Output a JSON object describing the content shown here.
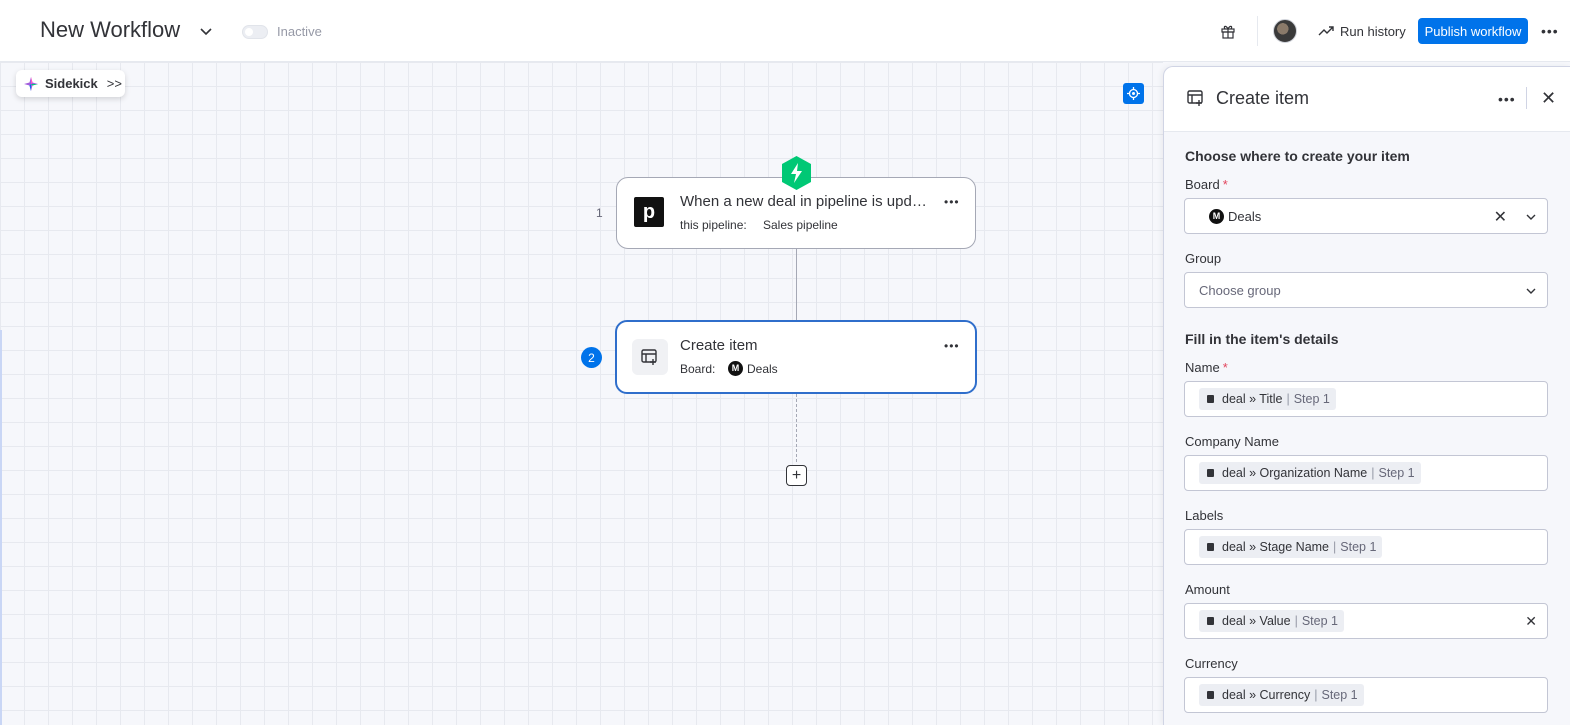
{
  "header": {
    "title": "New Workflow",
    "status": "Inactive",
    "run_history": "Run history",
    "publish": "Publish workflow"
  },
  "canvas": {
    "sidekick": "Sidekick",
    "nodes": [
      {
        "number": "1",
        "title": "When a new deal in pipeline is updated",
        "sub_label": "this pipeline:",
        "sub_value": "Sales pipeline",
        "logo_letter": "p"
      },
      {
        "number": "2",
        "title": "Create item",
        "sub_label": "Board:",
        "board_letter": "M",
        "board_value": "Deals"
      }
    ]
  },
  "panel": {
    "title": "Create item",
    "section1": "Choose where to create your item",
    "board": {
      "label": "Board",
      "required": "*",
      "letter": "M",
      "value": "Deals"
    },
    "group": {
      "label": "Group",
      "placeholder": "Choose group"
    },
    "section2": "Fill in the item's details",
    "fields": [
      {
        "label": "Name",
        "required": "*",
        "chip": "deal » Title",
        "step": "Step 1"
      },
      {
        "label": "Company Name",
        "chip": "deal » Organization Name",
        "step": "Step 1"
      },
      {
        "label": "Labels",
        "chip": "deal » Stage Name",
        "step": "Step 1"
      },
      {
        "label": "Amount",
        "chip": "deal » Value",
        "step": "Step 1"
      },
      {
        "label": "Currency",
        "chip": "deal » Currency",
        "step": "Step 1"
      }
    ]
  },
  "colors": {
    "primary": "#0073ea",
    "trigger_green": "#00c875",
    "required": "#e2445c"
  },
  "icons": [
    "chevron-down-icon",
    "gift-icon",
    "trend-icon",
    "more-icon",
    "sidekick-icon",
    "locate-icon",
    "bolt-icon",
    "create-item-icon",
    "close-icon",
    "plus-icon"
  ]
}
